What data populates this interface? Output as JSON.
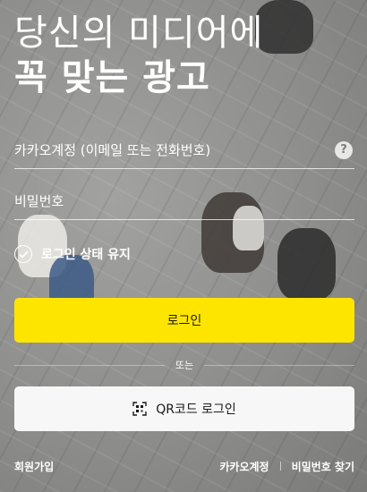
{
  "headline": {
    "line1": "당신의 미디어에",
    "line2": "꼭 맞는 광고"
  },
  "form": {
    "id_placeholder": "카카오계정 (이메일 또는 전화번호)",
    "id_value": "",
    "help_icon": "question-circle-icon",
    "password_placeholder": "비밀번호",
    "password_value": "",
    "keep_login_label": "로그인 상태 유지",
    "keep_login_checked": true,
    "login_button": "로그인",
    "or_text": "또는",
    "qr_button": "QR코드 로그인",
    "qr_icon": "qr-code-icon"
  },
  "footer": {
    "signup": "회원가입",
    "find_account": "카카오계정",
    "find_password": "비밀번호 찾기"
  },
  "colors": {
    "login_button_bg": "#fee500",
    "qr_button_bg": "#f7f7f7",
    "button_text": "#191919",
    "text": "#ffffff"
  }
}
